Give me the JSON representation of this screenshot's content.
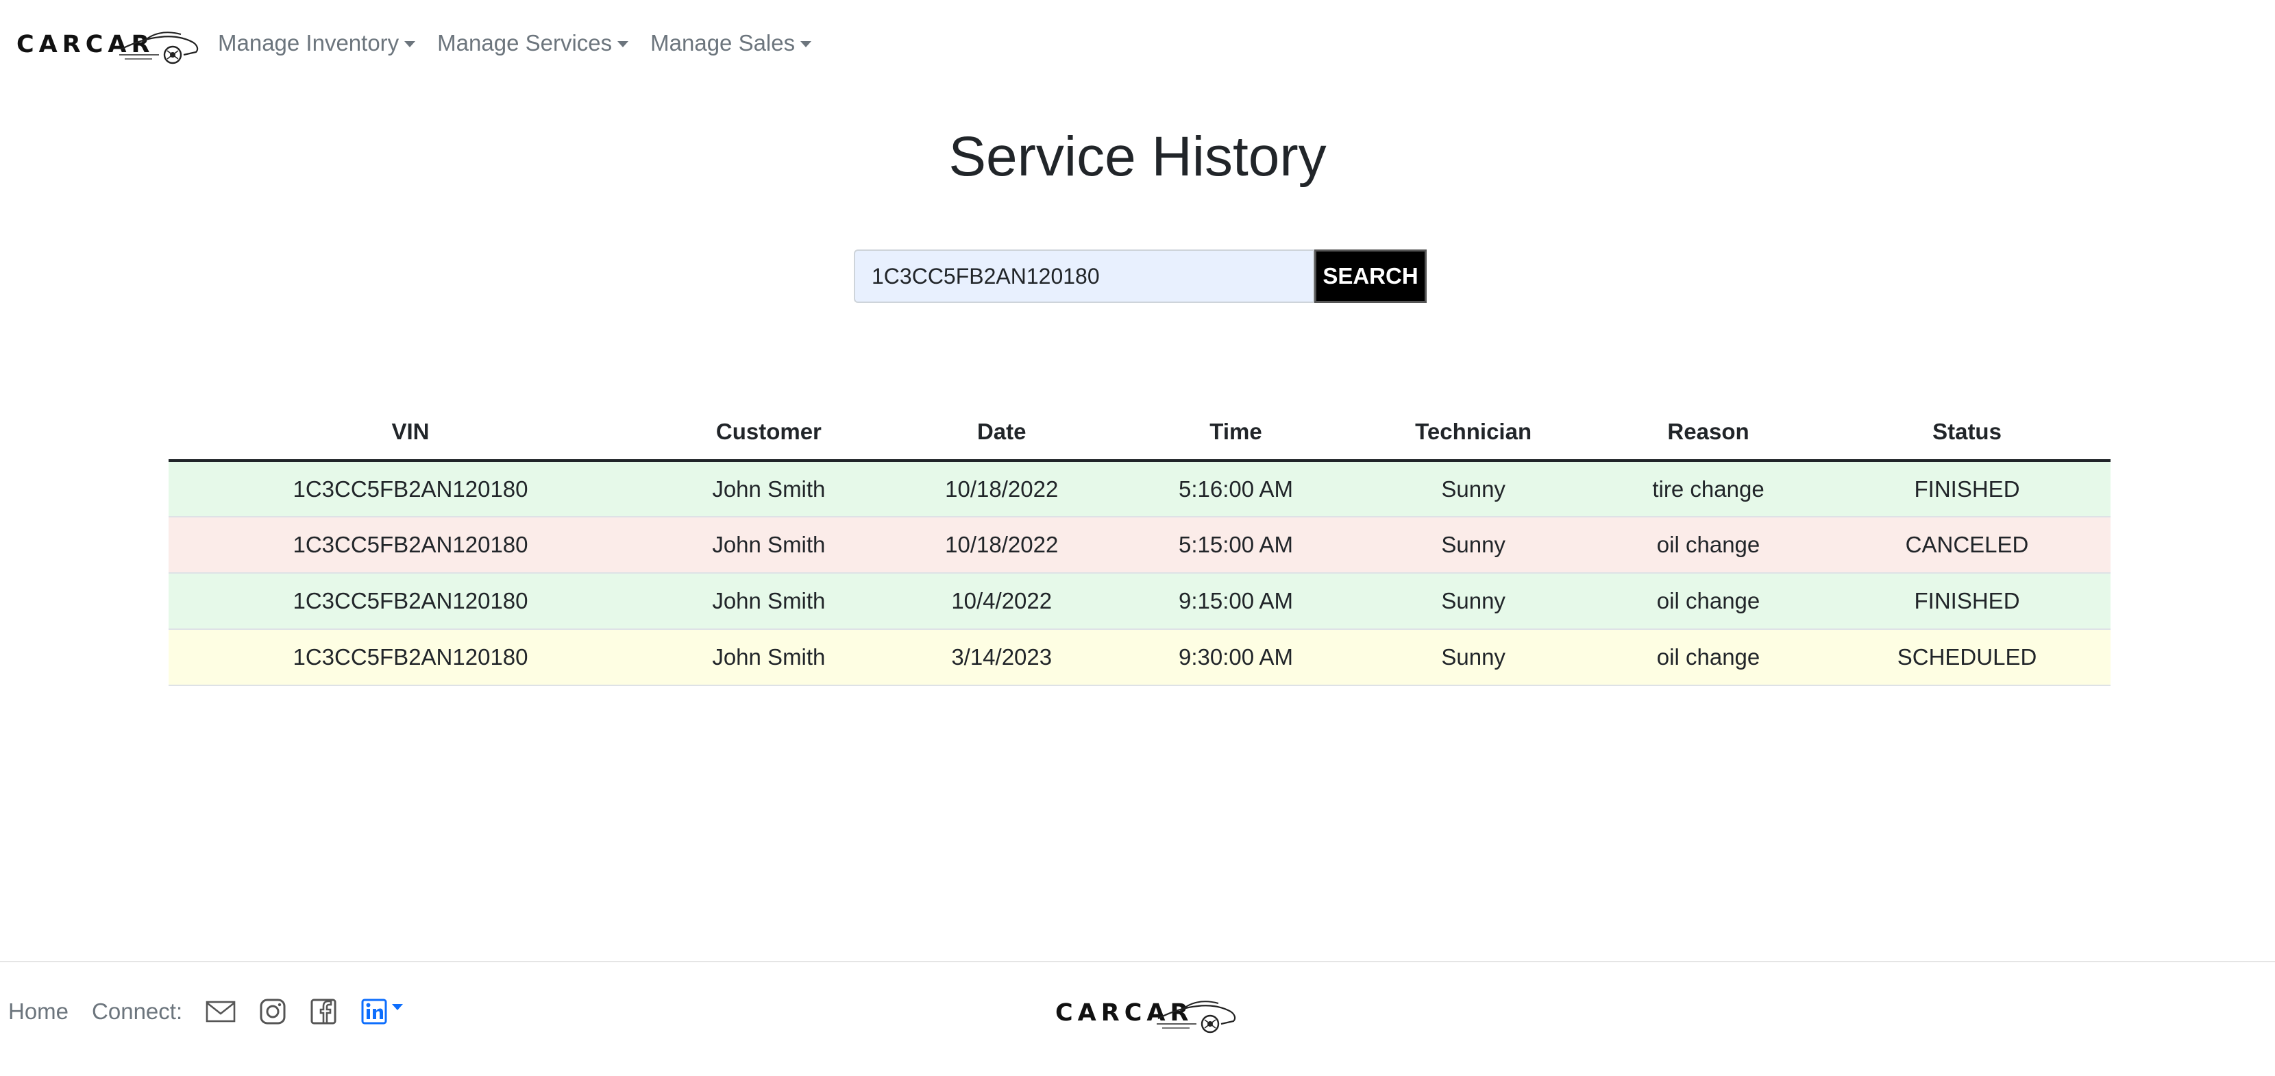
{
  "brand": {
    "name": "CARCAR"
  },
  "nav": {
    "items": [
      {
        "label": "Manage Inventory"
      },
      {
        "label": "Manage Services"
      },
      {
        "label": "Manage Sales"
      }
    ]
  },
  "page": {
    "title": "Service History"
  },
  "search": {
    "value": "1C3CC5FB2AN120180",
    "button_label": "SEARCH"
  },
  "table": {
    "headers": [
      "VIN",
      "Customer",
      "Date",
      "Time",
      "Technician",
      "Reason",
      "Status"
    ],
    "rows": [
      {
        "vin": "1C3CC5FB2AN120180",
        "customer": "John Smith",
        "date": "10/18/2022",
        "time": "5:16:00 AM",
        "technician": "Sunny",
        "reason": "tire change",
        "status": "FINISHED"
      },
      {
        "vin": "1C3CC5FB2AN120180",
        "customer": "John Smith",
        "date": "10/18/2022",
        "time": "5:15:00 AM",
        "technician": "Sunny",
        "reason": "oil change",
        "status": "CANCELED"
      },
      {
        "vin": "1C3CC5FB2AN120180",
        "customer": "John Smith",
        "date": "10/4/2022",
        "time": "9:15:00 AM",
        "technician": "Sunny",
        "reason": "oil change",
        "status": "FINISHED"
      },
      {
        "vin": "1C3CC5FB2AN120180",
        "customer": "John Smith",
        "date": "3/14/2023",
        "time": "9:30:00 AM",
        "technician": "Sunny",
        "reason": "oil change",
        "status": "SCHEDULED"
      }
    ]
  },
  "status_colors": {
    "FINISHED": "#e6f9e9",
    "CANCELED": "#fbece9",
    "SCHEDULED": "#fefee3"
  },
  "footer": {
    "home_label": "Home",
    "connect_label": "Connect:",
    "icons": [
      "mail-icon",
      "instagram-icon",
      "facebook-icon",
      "linkedin-icon"
    ],
    "linkedin_color": "#0d6efd"
  }
}
